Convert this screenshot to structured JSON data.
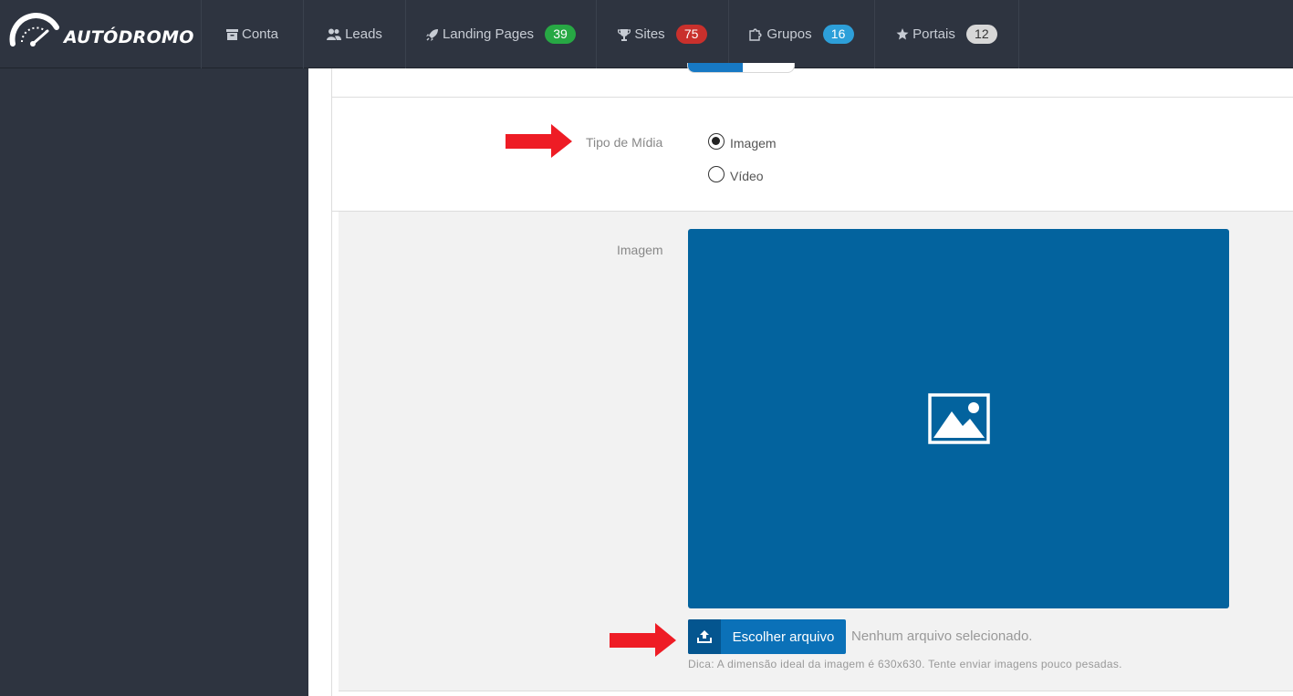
{
  "brand": {
    "name": "AUTÓDROMO"
  },
  "nav": {
    "items": [
      {
        "label": "Conta",
        "icon": "archive-icon"
      },
      {
        "label": "Leads",
        "icon": "users-icon"
      },
      {
        "label": "Landing Pages",
        "icon": "rocket-icon",
        "badge": "39",
        "badge_color": "#27a844"
      },
      {
        "label": "Sites",
        "icon": "trophy-icon",
        "badge": "75",
        "badge_color": "#c9302c"
      },
      {
        "label": "Grupos",
        "icon": "puzzle-icon",
        "badge": "16",
        "badge_color": "#2d9fd9"
      },
      {
        "label": "Portais",
        "icon": "star-icon",
        "badge": "12",
        "badge_color": "#d7d7d7"
      }
    ]
  },
  "form": {
    "media_type": {
      "label": "Tipo de Mídia",
      "options": [
        {
          "label": "Imagem",
          "checked": true
        },
        {
          "label": "Vídeo",
          "checked": false
        }
      ]
    },
    "image": {
      "label": "Imagem",
      "choose_button": "Escolher arquivo",
      "no_file_text": "Nenhum arquivo selecionado.",
      "hint": "Dica: A dimensão ideal da imagem é 630x630. Tente enviar imagens pouco pesadas."
    }
  },
  "colors": {
    "nav_bg": "#2e3440",
    "accent_blue": "#0b71b8",
    "preview_bg": "#03639e",
    "annotation_arrow": "#ee1c25"
  }
}
